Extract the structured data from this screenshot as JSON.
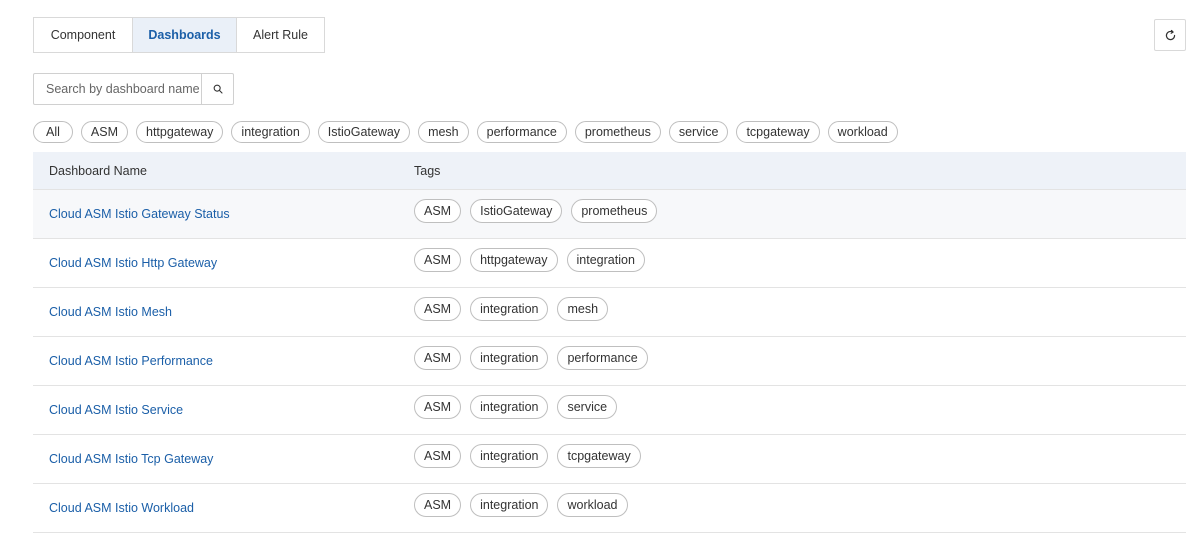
{
  "tabs": [
    {
      "label": "Component",
      "active": false
    },
    {
      "label": "Dashboards",
      "active": true
    },
    {
      "label": "Alert Rule",
      "active": false
    }
  ],
  "refresh": {
    "icon": "refresh-icon"
  },
  "search": {
    "placeholder": "Search by dashboard name",
    "value": "",
    "icon": "search-icon"
  },
  "filter_tags": [
    "All",
    "ASM",
    "httpgateway",
    "integration",
    "IstioGateway",
    "mesh",
    "performance",
    "prometheus",
    "service",
    "tcpgateway",
    "workload"
  ],
  "table": {
    "headers": {
      "name": "Dashboard Name",
      "tags": "Tags"
    },
    "rows": [
      {
        "name": "Cloud ASM Istio Gateway Status",
        "tags": [
          "ASM",
          "IstioGateway",
          "prometheus"
        ]
      },
      {
        "name": "Cloud ASM Istio Http Gateway",
        "tags": [
          "ASM",
          "httpgateway",
          "integration"
        ]
      },
      {
        "name": "Cloud ASM Istio Mesh",
        "tags": [
          "ASM",
          "integration",
          "mesh"
        ]
      },
      {
        "name": "Cloud ASM Istio Performance",
        "tags": [
          "ASM",
          "integration",
          "performance"
        ]
      },
      {
        "name": "Cloud ASM Istio Service",
        "tags": [
          "ASM",
          "integration",
          "service"
        ]
      },
      {
        "name": "Cloud ASM Istio Tcp Gateway",
        "tags": [
          "ASM",
          "integration",
          "tcpgateway"
        ]
      },
      {
        "name": "Cloud ASM Istio Workload",
        "tags": [
          "ASM",
          "integration",
          "workload"
        ]
      }
    ]
  },
  "colors": {
    "accent": "#1b5fa8",
    "active_tab_bg": "#eaf0f8",
    "header_bg": "#eef2f8",
    "border": "#d9d9d9"
  }
}
